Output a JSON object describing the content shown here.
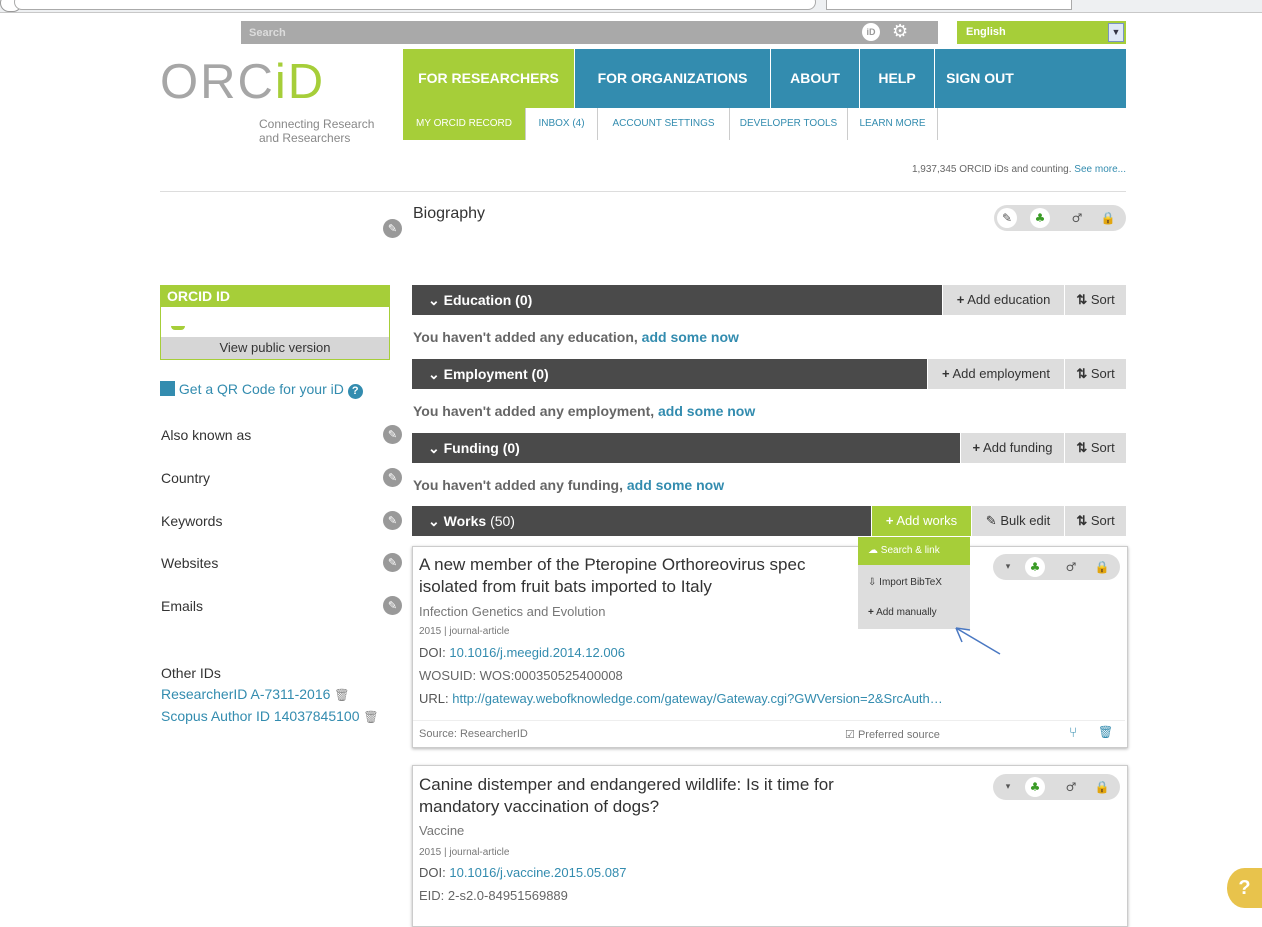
{
  "search": {
    "placeholder": "Search"
  },
  "language": {
    "selected": "English"
  },
  "logo": {
    "main": "ORC",
    "accent": "iD"
  },
  "tagline": {
    "line1": "Connecting Research",
    "line2": "and Researchers"
  },
  "nav": {
    "for_researchers": "FOR RESEARCHERS",
    "for_organizations": "FOR ORGANIZATIONS",
    "about": "ABOUT",
    "help": "HELP",
    "sign_out": "SIGN OUT"
  },
  "subnav": {
    "my_record": "MY ORCID RECORD",
    "inbox": "INBOX (4)",
    "account": "ACCOUNT SETTINGS",
    "developer": "DEVELOPER TOOLS",
    "learn": "LEARN MORE"
  },
  "counter": {
    "text": "1,937,345 ORCID iDs and counting.",
    "link": "See more..."
  },
  "biography": {
    "title": "Biography"
  },
  "sidebar": {
    "orcid_id_header": "ORCID ID",
    "view_public": "View public version",
    "qr_code": "Get a QR Code for your iD",
    "also_known_as": "Also known as",
    "country": "Country",
    "keywords": "Keywords",
    "websites": "Websites",
    "emails": "Emails",
    "other_ids": "Other IDs",
    "researcher_id": "ResearcherID A-7311-2016",
    "scopus_id": "Scopus Author ID 14037845100"
  },
  "sections": {
    "education": {
      "title": "Education (0)",
      "add": "Add education",
      "sort": "Sort",
      "empty": "You haven't added any education,",
      "empty_link": "add some now"
    },
    "employment": {
      "title": "Employment (0)",
      "add": "Add employment",
      "sort": "Sort",
      "empty": "You haven't added any employment,",
      "empty_link": "add some now"
    },
    "funding": {
      "title": "Funding (0)",
      "add": "Add funding",
      "sort": "Sort",
      "empty": "You haven't added any funding,",
      "empty_link": "add some now"
    },
    "works": {
      "title": "Works",
      "count": "(50)",
      "add": "Add works",
      "bulk": "Bulk edit",
      "sort": "Sort"
    }
  },
  "dropdown": {
    "search_link": "Search & link",
    "import_bibtex": "Import BibTeX",
    "add_manually": "Add manually"
  },
  "works": [
    {
      "title_line1": "A new member of the Pteropine Orthoreovirus spec",
      "title_line2": "isolated from fruit bats imported to Italy",
      "journal": "Infection Genetics and Evolution",
      "meta": "2015 | journal-article",
      "doi_label": "DOI:",
      "doi": "10.1016/j.meegid.2014.12.006",
      "wosuid": "WOSUID: WOS:000350525400008",
      "url_label": "URL:",
      "url": "http://gateway.webofknowledge.com/gateway/Gateway.cgi?GWVersion=2&SrcAuth…",
      "source": "Source: ResearcherID",
      "preferred": "Preferred source"
    },
    {
      "title_line1": "Canine distemper and endangered wildlife: Is it time for",
      "title_line2": "mandatory vaccination of dogs?",
      "journal": "Vaccine",
      "meta": "2015 | journal-article",
      "doi_label": "DOI:",
      "doi": "10.1016/j.vaccine.2015.05.087",
      "eid": "EID: 2-s2.0-84951569889"
    }
  ],
  "colors": {
    "brand_green": "#a6ce39",
    "brand_blue": "#338caf",
    "section_dark": "#4a4a4a"
  }
}
